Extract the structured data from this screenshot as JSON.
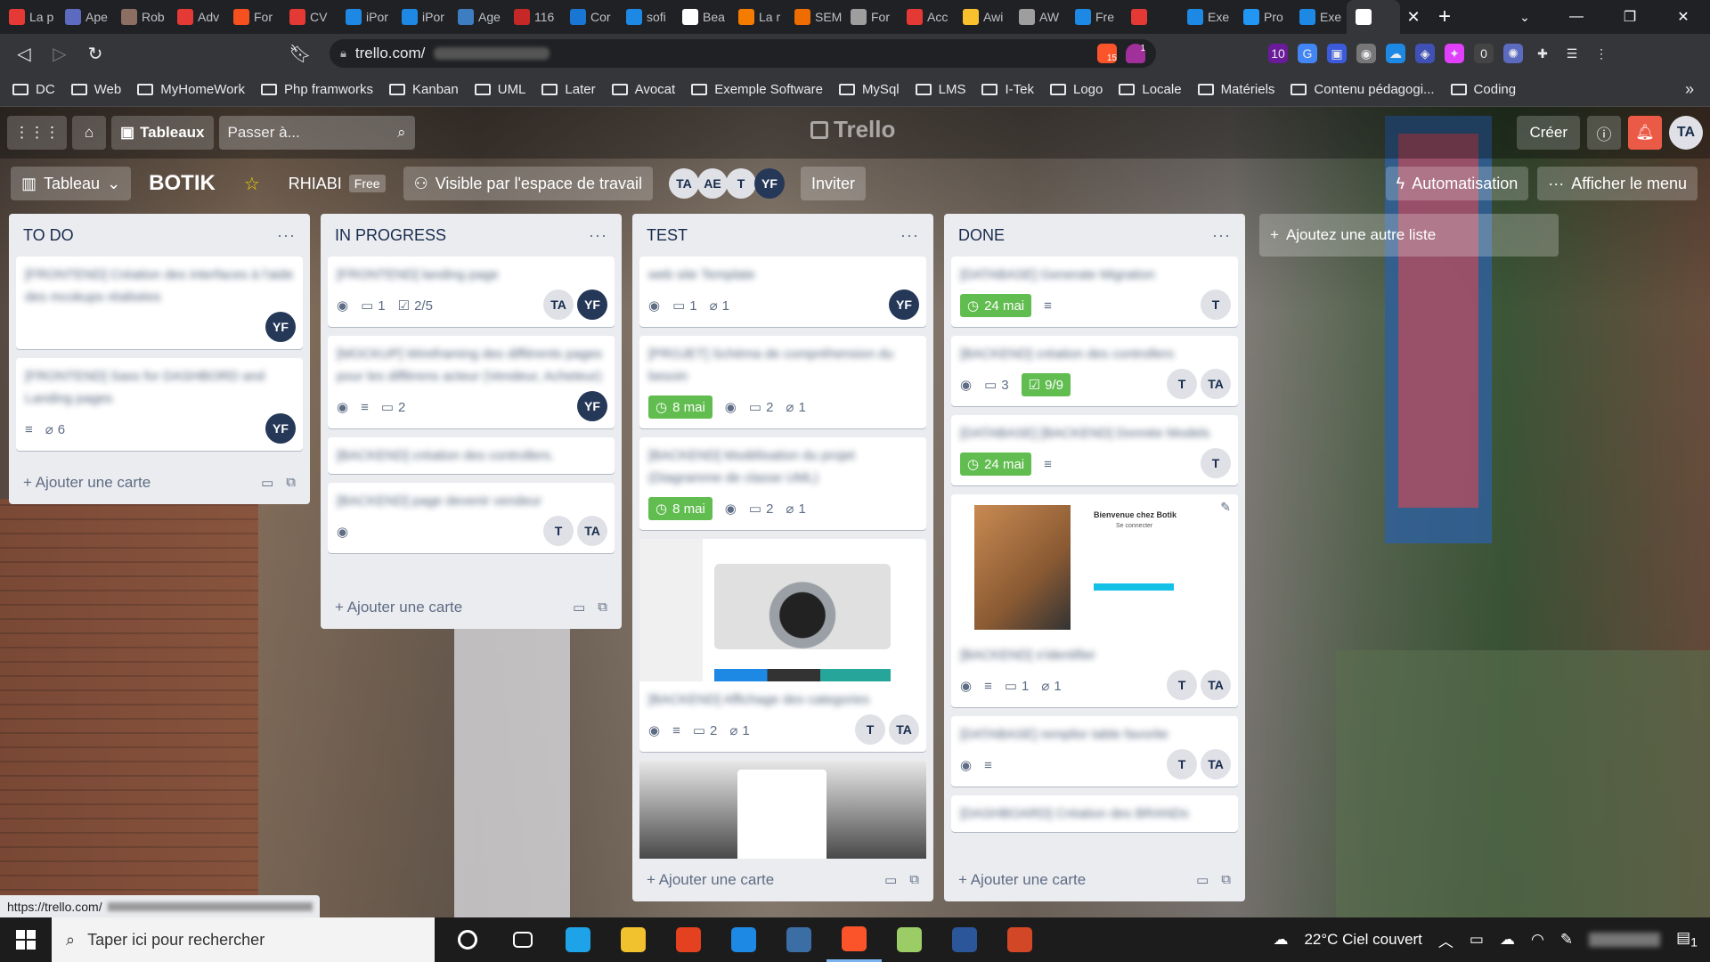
{
  "browser": {
    "tabs": [
      {
        "label": "La p",
        "color": "#e53935"
      },
      {
        "label": "Ape",
        "color": "#5c6bc0"
      },
      {
        "label": "Rob",
        "color": "#8d6e63"
      },
      {
        "label": "Adv",
        "color": "#e53935"
      },
      {
        "label": "For",
        "color": "#f4511e"
      },
      {
        "label": "CV",
        "color": "#e53935"
      },
      {
        "label": "iPor",
        "color": "#1e88e5"
      },
      {
        "label": "iPor",
        "color": "#1e88e5"
      },
      {
        "label": "Age",
        "color": "#3d7dc2"
      },
      {
        "label": "116",
        "color": "#c62828"
      },
      {
        "label": "Cor",
        "color": "#1976d2"
      },
      {
        "label": "sofi",
        "color": "#1e88e5"
      },
      {
        "label": "Bea",
        "color": "#ffffff"
      },
      {
        "label": "La r",
        "color": "#f57c00"
      },
      {
        "label": "SEM",
        "color": "#ef6c00"
      },
      {
        "label": "For",
        "color": "#9e9e9e"
      },
      {
        "label": "Acc",
        "color": "#e53935"
      },
      {
        "label": "Awi",
        "color": "#fbc02d"
      },
      {
        "label": "AW",
        "color": "#9e9e9e"
      },
      {
        "label": "Fre",
        "color": "#1e88e5"
      },
      {
        "label": "",
        "color": "#e53935"
      },
      {
        "label": "Exe",
        "color": "#1e88e5"
      },
      {
        "label": "Pro",
        "color": "#2196f3"
      },
      {
        "label": "Exe",
        "color": "#1e88e5"
      }
    ],
    "url": "trello.com/",
    "shield_count": "15",
    "alert_count": "1",
    "ext_badges": [
      "10",
      "0"
    ],
    "bookmarks": [
      "DC",
      "Web",
      "MyHomeWork",
      "Php framworks",
      "Kanban",
      "UML",
      "Later",
      "Avocat",
      "Exemple Software",
      "MySql",
      "LMS",
      "I-Tek",
      "Logo",
      "Locale",
      "Matériels",
      "Contenu pédagogi...",
      "Coding"
    ],
    "bookmarks_more": "»",
    "status_url": "https://trello.com/"
  },
  "trello": {
    "boards_label": "Tableaux",
    "search_placeholder": "Passer à...",
    "logo": "Trello",
    "create_label": "Créer",
    "user_initials": "TA",
    "view_label": "Tableau",
    "board_name": "BOTIK",
    "workspace": "RHIABI",
    "free_label": "Free",
    "visibility_label": "Visible par l'espace de travail",
    "members": [
      {
        "initials": "TA",
        "dark": false
      },
      {
        "initials": "AE",
        "dark": false
      },
      {
        "initials": "T",
        "dark": false
      },
      {
        "initials": "YF",
        "dark": true
      }
    ],
    "invite_label": "Inviter",
    "automation_label": "Automatisation",
    "menu_label": "Afficher le menu",
    "add_list_label": "Ajoutez une autre liste",
    "add_card_label": "Ajouter une carte"
  },
  "lists": [
    {
      "title": "TO DO",
      "cards": [
        {
          "title": "[FRONTEND] Création des interfaces à l'aide des mcokups réalisées",
          "members": [
            {
              "i": "YF",
              "dark": true
            }
          ]
        },
        {
          "title": "[FRONTEND] Sass for DASHBORD and Landing pages",
          "desc": true,
          "attach": "6",
          "members": [
            {
              "i": "YF",
              "dark": true
            }
          ]
        }
      ]
    },
    {
      "title": "IN PROGRESS",
      "cards": [
        {
          "title": "[FRONTEND] landing page",
          "watch": true,
          "comments": "1",
          "checklist": "2/5",
          "members": [
            {
              "i": "TA",
              "dark": false
            },
            {
              "i": "YF",
              "dark": true
            }
          ]
        },
        {
          "title": "[MOCKUP] Wireframing des différents pages pour les différens acteur (Vendeur, Acheteur)",
          "watch": true,
          "desc": true,
          "comments": "2",
          "members": [
            {
              "i": "YF",
              "dark": true
            }
          ]
        },
        {
          "title": "[BACKEND] création des controllers.",
          "members": []
        },
        {
          "title": "[BACKEND] page devenir vendeur",
          "watch": true,
          "members": [
            {
              "i": "T",
              "dark": false
            },
            {
              "i": "TA",
              "dark": false
            }
          ]
        }
      ]
    },
    {
      "title": "TEST",
      "cards": [
        {
          "title": "web site Template",
          "watch": true,
          "comments": "1",
          "attach": "1",
          "members": [
            {
              "i": "YF",
              "dark": true
            }
          ]
        },
        {
          "title": "[PROJET] Schéma de compréhension du besoin",
          "watch": true,
          "due": "8 mai",
          "comments": "2",
          "attach": "1",
          "members": []
        },
        {
          "title": "[BACKEND] Modélisation du projet (Diagramme de classe UML)",
          "watch": true,
          "due": "8 mai",
          "comments": "2",
          "attach": "1",
          "members": []
        },
        {
          "title": "[BACKEND] Affichage des categories",
          "cover": "camera",
          "watch": true,
          "desc": true,
          "comments": "2",
          "attach": "1",
          "members": [
            {
              "i": "T",
              "dark": false
            },
            {
              "i": "TA",
              "dark": false
            }
          ]
        },
        {
          "title": "",
          "cover": "form",
          "members": []
        }
      ]
    },
    {
      "title": "DONE",
      "cards": [
        {
          "title": "[DATABASE] Generate Migration",
          "due": "24 mai",
          "desc": true,
          "members": [
            {
              "i": "T",
              "dark": false
            }
          ]
        },
        {
          "title": "[BACKEND] création des controllers",
          "watch": true,
          "comments": "3",
          "checklist": "9/9",
          "members": [
            {
              "i": "T",
              "dark": false
            },
            {
              "i": "TA",
              "dark": false
            }
          ]
        },
        {
          "title": "[DATABASE] [BACKEND] Donnée Models",
          "due": "24 mai",
          "desc": true,
          "members": [
            {
              "i": "T",
              "dark": false
            }
          ]
        },
        {
          "title": "[BACKEND] s'identifier",
          "cover": "login",
          "cover_heading": "Bienvenue chez Botik",
          "cover_sub": "Se connecter",
          "watch": true,
          "desc": true,
          "comments": "1",
          "attach": "1",
          "members": [
            {
              "i": "T",
              "dark": false
            },
            {
              "i": "TA",
              "dark": false
            }
          ]
        },
        {
          "title": "[DATABASE] remplisr table favorite",
          "watch": true,
          "desc": true,
          "members": [
            {
              "i": "T",
              "dark": false
            },
            {
              "i": "TA",
              "dark": false
            }
          ]
        },
        {
          "title": "[DASHBOARD] Création des BRANDs",
          "members": []
        }
      ]
    }
  ],
  "taskbar": {
    "search_placeholder": "Taper ici pour rechercher",
    "apps": [
      {
        "name": "cortana",
        "color": "#1c1c1c"
      },
      {
        "name": "task-view",
        "color": "#1c1c1c"
      },
      {
        "name": "edge",
        "color": "#1fa3e8"
      },
      {
        "name": "explorer",
        "color": "#f2c12e"
      },
      {
        "name": "office",
        "color": "#e3411f"
      },
      {
        "name": "vscode",
        "color": "#1e88e5"
      },
      {
        "name": "app",
        "color": "#3a6ea5"
      },
      {
        "name": "brave",
        "color": "#fb542b"
      },
      {
        "name": "paint",
        "color": "#9ccc65"
      },
      {
        "name": "word",
        "color": "#2b579a"
      },
      {
        "name": "powerpoint",
        "color": "#d24726"
      }
    ],
    "weather": "22°C  Ciel couvert",
    "notif_count": "1"
  }
}
